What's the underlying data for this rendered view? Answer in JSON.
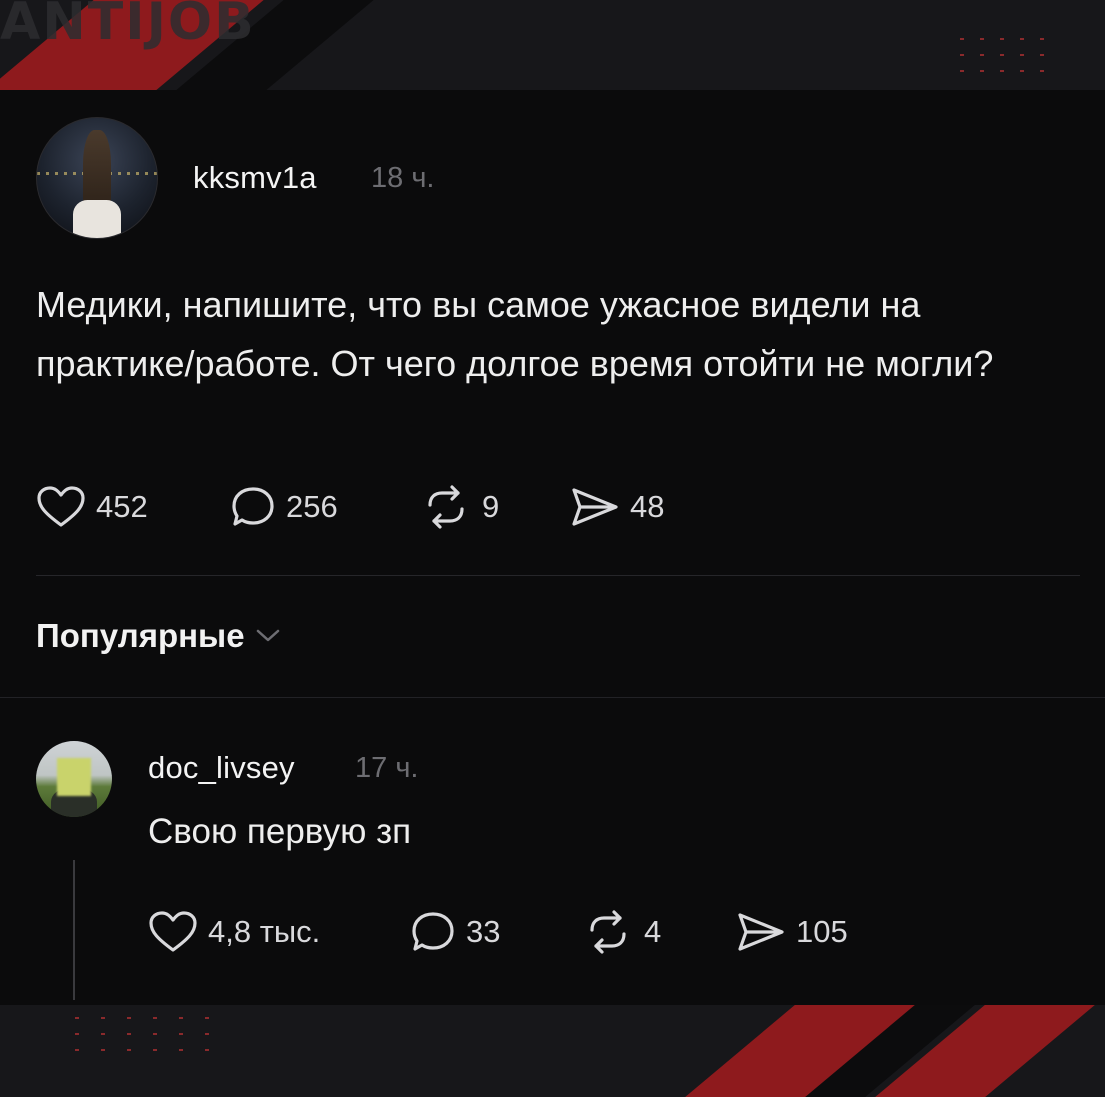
{
  "watermark": "ANTIJOB",
  "post": {
    "username": "kksmv1a",
    "time": "18 ч.",
    "text": "Медики, напишите, что вы самое ужасное видели на практике/работе. От чего долгое время отойти не могли?",
    "likes": "452",
    "comments": "256",
    "reposts": "9",
    "shares": "48"
  },
  "sort": {
    "label": "Популярные",
    "icon": "chevron-down-icon"
  },
  "comment": {
    "username": "doc_livsey",
    "time": "17 ч.",
    "text": "Свою первую зп",
    "likes": "4,8 тыс.",
    "comments": "33",
    "reposts": "4",
    "shares": "105"
  },
  "colors": {
    "background": "#0b0b0c",
    "accent_red": "#8e1a1d",
    "muted_text": "#6d6d72"
  }
}
